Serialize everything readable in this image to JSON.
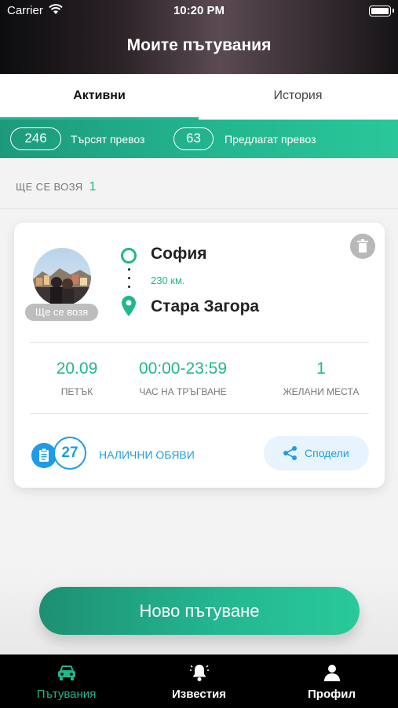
{
  "status_bar": {
    "carrier": "Carrier",
    "time": "10:20 PM"
  },
  "header": {
    "title": "Моите пътувания"
  },
  "tabs": [
    {
      "label": "Активни",
      "active": true
    },
    {
      "label": "История",
      "active": false
    }
  ],
  "stats": {
    "searching": {
      "count": "246",
      "label": "Търсят превоз"
    },
    "offering": {
      "count": "63",
      "label": "Предлагат превоз"
    }
  },
  "section": {
    "label": "ЩЕ СЕ ВОЗЯ",
    "count": "1"
  },
  "trip": {
    "role_badge": "Ще се возя",
    "from": "София",
    "distance": "230 км.",
    "to": "Стара Загора",
    "date": {
      "value": "20.09",
      "label": "ПЕТЪК"
    },
    "time": {
      "value": "00:00-23:59",
      "label": "ЧАС НА ТРЪГВАНЕ"
    },
    "seats": {
      "value": "1",
      "label": "ЖЕЛАНИ МЕСТА"
    },
    "ads": {
      "count": "27",
      "label": "НАЛИЧНИ ОБЯВИ"
    },
    "share_label": "Сподели"
  },
  "new_trip_label": "Ново пътуване",
  "bottom_nav": [
    {
      "label": "Пътувания",
      "icon": "car-icon",
      "active": true
    },
    {
      "label": "Известия",
      "icon": "bell-icon",
      "active": false
    },
    {
      "label": "Профил",
      "icon": "person-icon",
      "active": false
    }
  ],
  "colors": {
    "accent": "#21b78e",
    "link": "#1e9ce8",
    "badge": "#bdbdbd"
  }
}
